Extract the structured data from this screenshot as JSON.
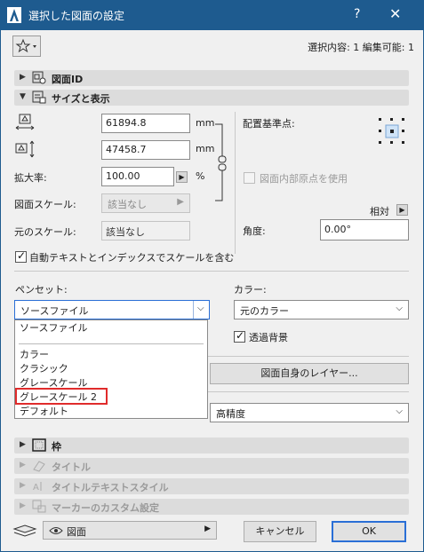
{
  "window": {
    "title": "選択した図面の設定",
    "help_label": "?",
    "close_label": "✕"
  },
  "header": {
    "selection_info": "選択内容: 1 編集可能: 1"
  },
  "sections": {
    "drawing_id": "図面ID",
    "size_display": "サイズと表示",
    "frame": "枠",
    "title": "タイトル",
    "title_text_style": "タイトルテキストスタイル",
    "marker_custom": "マーカーのカスタム設定"
  },
  "size": {
    "width_value": "61894.8",
    "height_value": "47458.7",
    "unit": "mm",
    "scale_label": "拡大率:",
    "scale_value": "100.00",
    "percent": "%",
    "drawing_scale_label": "図面スケール:",
    "drawing_scale_value": "該当なし",
    "original_scale_label": "元のスケール:",
    "original_scale_value": "該当なし",
    "anchor_label": "配置基準点:",
    "internal_origin_label": "図面内部原点を使用",
    "relative_label": "相対",
    "angle_label": "角度:",
    "angle_value": "0.00°",
    "auto_text_label": "自動テキストとインデックスでスケールを含む"
  },
  "pen": {
    "penset_label": "ペンセット:",
    "penset_value": "ソースファイル",
    "color_label": "カラー:",
    "color_value": "元のカラー",
    "transparent_label": "透過背景",
    "layer_button": "図面自身のレイヤー...",
    "quality_value": "高精度",
    "dropdown_items": [
      "ソースファイル",
      "カラー",
      "クラシック",
      "グレースケール",
      "グレースケール 2",
      "デフォルト"
    ]
  },
  "footer": {
    "view_value": "図面",
    "cancel": "キャンセル",
    "ok": "OK"
  },
  "colors": {
    "titlebar": "#1e5b8f",
    "highlight_border": "#e02b2b",
    "ok_border": "#2a6fd6"
  }
}
